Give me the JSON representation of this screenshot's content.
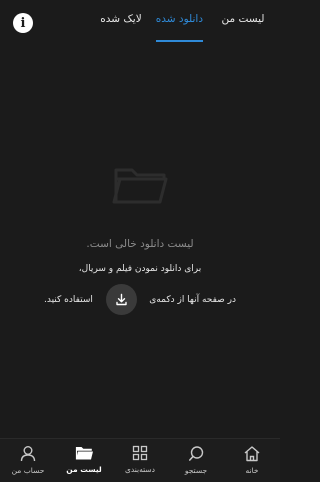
{
  "header": {
    "info_icon": "info-icon",
    "tabs": [
      {
        "label": "لیست من",
        "active": false
      },
      {
        "label": "دانلود شده",
        "active": true
      },
      {
        "label": "لایک شده",
        "active": false
      }
    ]
  },
  "empty_state": {
    "icon": "folder-icon",
    "title": "لیست دانلود خالی است.",
    "line1": "برای دانلود نمودن فیلم و سریال،",
    "line2_before": "در صفحه آنها از دکمه‌ی",
    "line2_after": "استفاده کنید.",
    "button_icon": "download-icon"
  },
  "bottom_nav": {
    "items": [
      {
        "label": "خانه",
        "icon": "home-icon",
        "active": false
      },
      {
        "label": "جستجو",
        "icon": "search-icon",
        "active": false
      },
      {
        "label": "دسته‌بندی",
        "icon": "grid-icon",
        "active": false
      },
      {
        "label": "لیست من",
        "icon": "folder-icon",
        "active": true
      },
      {
        "label": "حساب من",
        "icon": "user-icon",
        "active": false
      }
    ]
  },
  "colors": {
    "background": "#1b1b1b",
    "accent": "#2f8ad8",
    "muted_text": "#8c8c8c"
  }
}
